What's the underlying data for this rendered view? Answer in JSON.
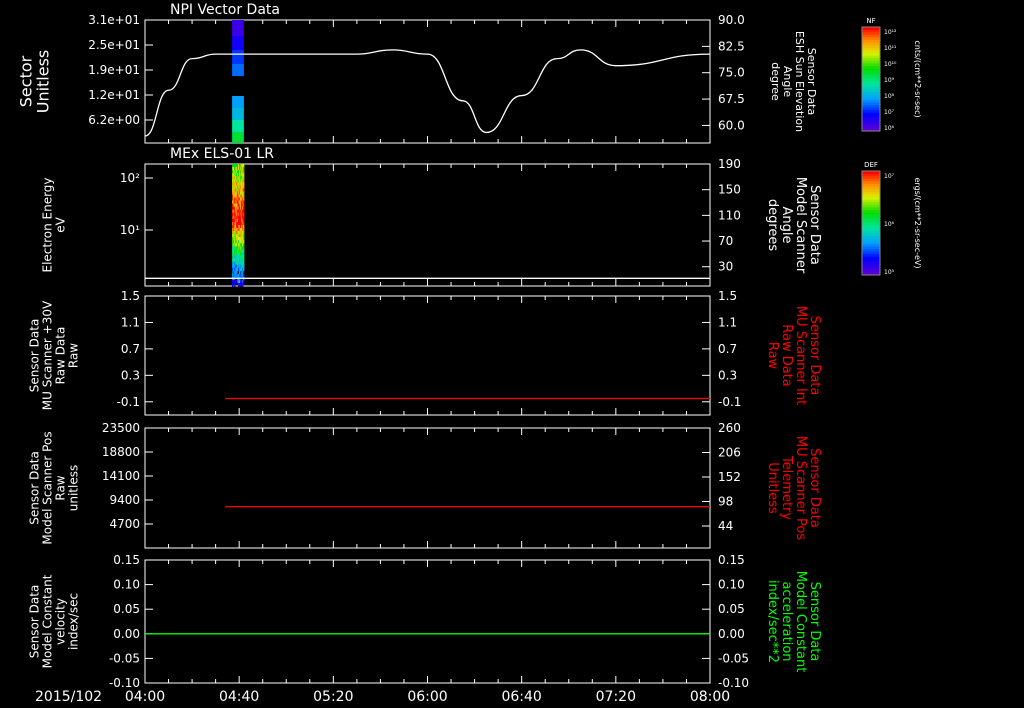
{
  "timeline": {
    "date_label": "2015/102",
    "ticks": [
      "04:00",
      "04:40",
      "05:20",
      "06:00",
      "06:40",
      "07:20",
      "08:00"
    ]
  },
  "colorbars": [
    {
      "title": "NF",
      "unit": "cnts/(cm**2-sr-sec)",
      "tick_labels": [
        "10¹²",
        "10¹¹",
        "10¹⁰",
        "10⁹",
        "10⁸",
        "10⁷",
        "10⁶"
      ]
    },
    {
      "title": "DEF",
      "unit": "ergs/(cm**2-sr-sec-eV)",
      "tick_labels": [
        "10⁷",
        "10⁶",
        "10⁵"
      ]
    }
  ],
  "colors": {
    "white": "#ffffff",
    "red": "#ff0000",
    "green": "#00ff00"
  },
  "chart_data": [
    {
      "type": "heatmap",
      "title": "NPI Vector Data",
      "ylabel_left": [
        "Sector",
        "Unitless"
      ],
      "yticks_left": [
        "3.1e+01",
        "2.5e+01",
        "1.9e+01",
        "1.2e+01",
        "6.2e+00"
      ],
      "ylabel_right": [
        "Sensor Data",
        "ESH Sun Elevation",
        "Angle",
        "degree"
      ],
      "yticks_right": [
        "90.0",
        "82.5",
        "75.0",
        "67.5",
        "60.0"
      ],
      "ylim_right": [
        55,
        90
      ],
      "line_series": {
        "color": "white",
        "x": [
          "04:00",
          "04:10",
          "04:20",
          "04:30",
          "05:00",
          "05:30",
          "05:45",
          "06:00",
          "06:15",
          "06:25",
          "06:40",
          "06:55",
          "07:05",
          "07:20",
          "08:00"
        ],
        "y": [
          57,
          70,
          79,
          80.3,
          80.3,
          80.3,
          81.5,
          80.3,
          67,
          58,
          68.5,
          79,
          81.5,
          77,
          80.3
        ]
      },
      "heatmap_x": [
        "04:37",
        "04:42"
      ]
    },
    {
      "type": "heatmap",
      "title": "MEx ELS-01 LR",
      "ylabel_left": [
        "Electron Energy",
        "eV"
      ],
      "yticks_left": [
        "10²",
        "10¹"
      ],
      "ylabel_right": [
        "Sensor Data",
        "Model Scanner",
        "Angle",
        "degrees"
      ],
      "yticks_right": [
        "190",
        "150",
        "110",
        "70",
        "30"
      ],
      "ylim_right": [
        0,
        190
      ],
      "line_series": {
        "color": "white",
        "x": [
          "04:00",
          "08:00"
        ],
        "y": [
          12,
          12
        ]
      },
      "heatmap_x": [
        "04:37",
        "04:42"
      ]
    },
    {
      "type": "line",
      "ylabel_left": [
        "Sensor Data",
        "MU Scanner +30V",
        "Raw Data",
        "Raw"
      ],
      "yticks_left": [
        "1.5",
        "1.1",
        "0.7",
        "0.3",
        "-0.1"
      ],
      "ylabel_right": [
        "Sensor Data",
        "MU Scanner Int",
        "Raw Data",
        "Raw"
      ],
      "yticks_right": [
        "1.5",
        "1.1",
        "0.7",
        "0.3",
        "-0.1"
      ],
      "ylim": [
        -0.3,
        1.5
      ],
      "series": [
        {
          "color": "red",
          "x": [
            "04:34",
            "08:00"
          ],
          "y": [
            -0.05,
            -0.05
          ]
        }
      ]
    },
    {
      "type": "line",
      "ylabel_left": [
        "Sensor Data",
        "Model Scanner Pos",
        "Raw",
        "unitless"
      ],
      "yticks_left": [
        "23500",
        "18800",
        "14100",
        "9400",
        "4700"
      ],
      "ylabel_right": [
        "Sensor Data",
        "MU Scanner Pos",
        "Telemetry",
        "Unitless"
      ],
      "yticks_right": [
        "260",
        "206",
        "152",
        "98",
        "44"
      ],
      "ylim": [
        0,
        23500
      ],
      "series": [
        {
          "color": "red",
          "x": [
            "04:34",
            "08:00"
          ],
          "y": [
            8100,
            8100
          ]
        }
      ]
    },
    {
      "type": "line",
      "ylabel_left": [
        "Sensor Data",
        "Model Constant",
        "velocity",
        "index/sec"
      ],
      "yticks_left": [
        "0.15",
        "0.10",
        "0.05",
        "0.00",
        "-0.05",
        "-0.10"
      ],
      "ylabel_right": [
        "Sensor Data",
        "Model Constant",
        "acceleration",
        "index/sec**2"
      ],
      "yticks_right": [
        "0.15",
        "0.10",
        "0.05",
        "0.00",
        "-0.05",
        "-0.10"
      ],
      "ylim": [
        -0.1,
        0.15
      ],
      "series": [
        {
          "color": "green",
          "x": [
            "04:00",
            "08:00"
          ],
          "y": [
            0.0,
            0.0
          ]
        }
      ]
    }
  ]
}
